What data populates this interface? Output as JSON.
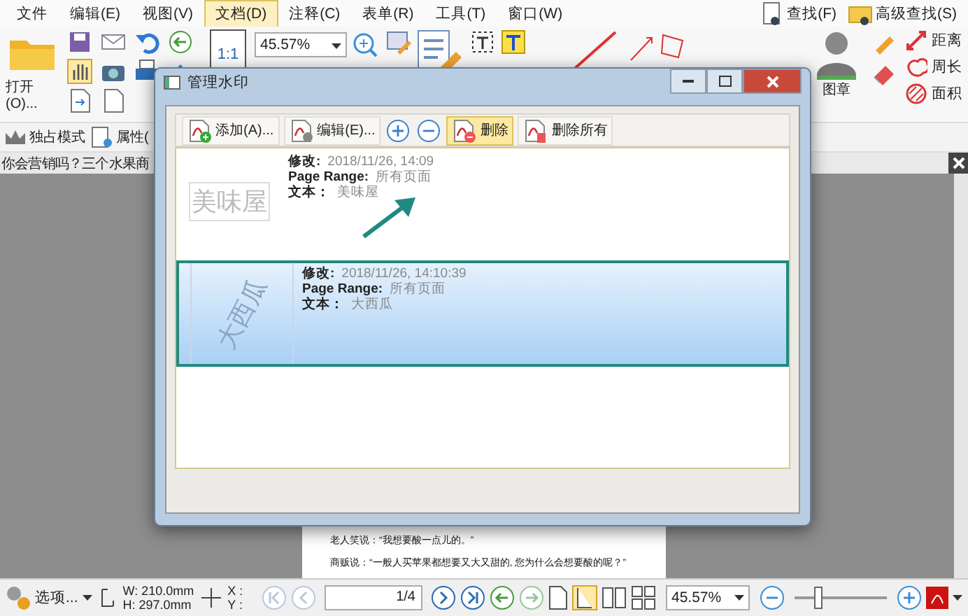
{
  "menu": [
    {
      "label": "文件",
      "selected": false
    },
    {
      "label": "编辑(E)",
      "selected": false
    },
    {
      "label": "视图(V)",
      "selected": false
    },
    {
      "label": "文档(D)",
      "selected": true
    },
    {
      "label": "注释(C)",
      "selected": false
    },
    {
      "label": "表单(R)",
      "selected": false
    },
    {
      "label": "工具(T)",
      "selected": false
    },
    {
      "label": "窗口(W)",
      "selected": false
    }
  ],
  "search_links": [
    "查找(F)",
    "高级查找(S)"
  ],
  "ribbon": {
    "open_label": "打开(O)...",
    "actual_size_label": "1:1",
    "zoom_value": "45.57%",
    "stamp_label": "图章",
    "measure": [
      "距离",
      "周长",
      "面积"
    ]
  },
  "toolbar": [
    {
      "label": "独占模式",
      "kind": "crown"
    },
    {
      "label": "属性(",
      "kind": "props"
    }
  ],
  "document_tab": "你会营销吗？三个水果商",
  "page_lines": [
    "老人笑说：“我想要酸一点儿的。”",
    "商贩说：“一般人买苹果都想要又大又甜的, 您为什么会想要酸的呢？”"
  ],
  "dialog": {
    "title": "管理水印",
    "tools": [
      {
        "kind": "add",
        "label": "添加(A)...",
        "selected": false
      },
      {
        "kind": "edit",
        "label": "编辑(E)...",
        "selected": false
      },
      {
        "kind": "plus",
        "selected": false
      },
      {
        "kind": "minus",
        "selected": false
      },
      {
        "kind": "delete",
        "label": "删除",
        "selected": true
      },
      {
        "kind": "delete_all",
        "label": "删除所有",
        "selected": false
      }
    ],
    "watermarks": [
      {
        "preview": "美味屋",
        "modified_label": "修改:",
        "modified": "2018/11/26, 14:09",
        "range_label": "Page Range:",
        "range": "所有页面",
        "text_label": "文本：",
        "text": "美味屋",
        "selected": false
      },
      {
        "preview": "大西瓜",
        "modified_label": "修改:",
        "modified": "2018/11/26, 14:10:39",
        "range_label": "Page Range:",
        "range": "所有页面",
        "text_label": "文本：",
        "text": "大西瓜",
        "selected": true
      }
    ]
  },
  "status_bar": {
    "options": "选项...",
    "width": "W: 210.0mm",
    "height": "H: 297.0mm",
    "x": "X :",
    "y": "Y :",
    "page": "1/4",
    "zoom": "45.57%",
    "zoom_slider": {
      "level": 0.25
    }
  }
}
